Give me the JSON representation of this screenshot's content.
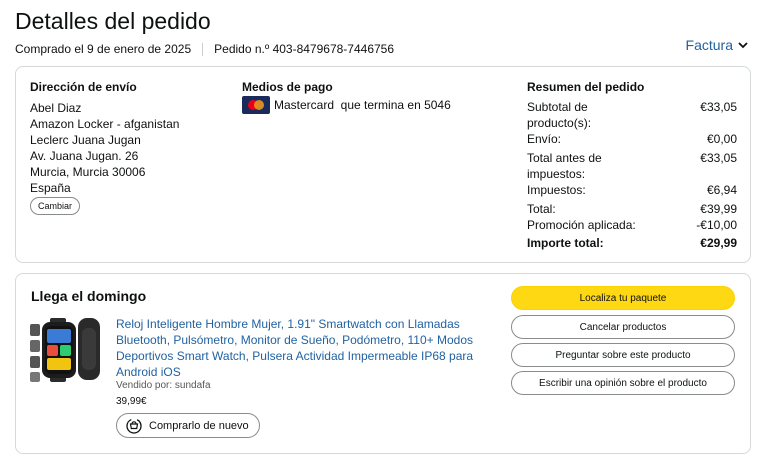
{
  "header": {
    "title": "Detalles del pedido",
    "ordered_on": "Comprado el 9 de enero de 2025",
    "order_number": "Pedido n.º 403-8479678-7446756",
    "invoice_label": "Factura"
  },
  "shipping": {
    "heading": "Dirección de envío",
    "lines": [
      "Abel Diaz",
      "Amazon Locker - afganistan",
      "Leclerc Juana Jugan",
      "Av. Juana Jugan. 26",
      "Murcia, Murcia 30006",
      "España"
    ],
    "change_label": "Cambiar"
  },
  "payment": {
    "heading": "Medios de pago",
    "method": "Mastercard  que termina en 5046",
    "card_icon": "mastercard-icon"
  },
  "summary": {
    "heading": "Resumen del pedido",
    "rows": [
      {
        "label": "Subtotal de producto(s):",
        "value": "€33,05"
      },
      {
        "label": "Envío:",
        "value": "€0,00"
      },
      {
        "label": "Total antes de impuestos:",
        "value": "€33,05"
      },
      {
        "label": "Impuestos:",
        "value": "€6,94"
      },
      {
        "label": "Total:",
        "value": "€39,99"
      },
      {
        "label": "Promoción aplicada:",
        "value": "-€10,00"
      },
      {
        "label": "Importe total:",
        "value": "€29,99"
      }
    ]
  },
  "delivery": {
    "title": "Llega el domingo",
    "product_title": "Reloj Inteligente Hombre Mujer, 1.91\" Smartwatch con Llamadas Bluetooth, Pulsómetro, Monitor de Sueño, Podómetro, 110+ Modos Deportivos Smart Watch, Pulsera Actividad Impermeable IP68 para Android iOS",
    "seller": "Vendido por: sundafa",
    "price": "39,99€",
    "rebuy_label": "Comprarlo de nuevo",
    "actions": {
      "track": "Localiza tu paquete",
      "cancel": "Cancelar productos",
      "ask": "Preguntar sobre este producto",
      "review": "Escribir una opinión sobre el producto"
    }
  },
  "colors": {
    "link": "#2162a1",
    "primary_button": "#ffd814",
    "border": "#d5d9d9"
  }
}
